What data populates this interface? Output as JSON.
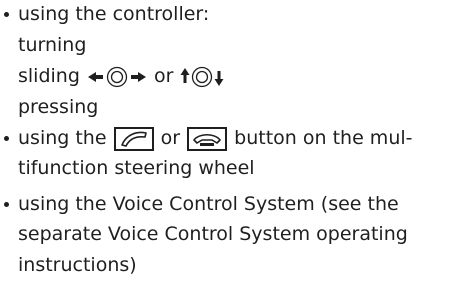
{
  "items": [
    {
      "lead": "using the controller:",
      "sub": [
        "turning",
        "sliding",
        "or",
        "pressing"
      ]
    },
    {
      "line1_a": "using the",
      "line1_or": "or",
      "line1_b": "button on the mul-",
      "line2": "tifunction steering wheel"
    },
    {
      "line1": "using the Voice Control System (see the",
      "line2": "separate Voice Control System operating",
      "line3": "instructions)"
    }
  ],
  "icons": {
    "controller_slide_horizontal": "controller-slide-left-right-icon",
    "controller_slide_vertical": "controller-slide-up-down-icon",
    "phone_accept": "phone-accept-icon",
    "phone_end": "phone-end-icon"
  }
}
